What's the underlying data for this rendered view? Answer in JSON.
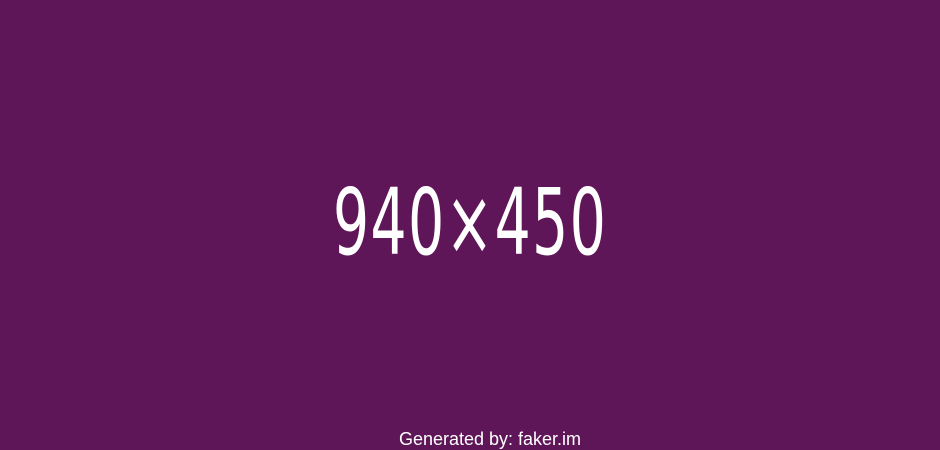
{
  "placeholder": {
    "dimensions_label": "940×450",
    "credit_label": "Generated by: faker.im",
    "background_color": "#5e1658",
    "text_color": "#ffffff"
  }
}
